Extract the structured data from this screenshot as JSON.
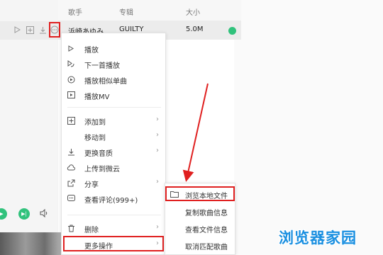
{
  "table": {
    "headers": {
      "artist": "歌手",
      "album": "专辑",
      "size": "大小"
    },
    "row": {
      "artist": "浜崎あゆみ",
      "album": "GUILTY",
      "size": "5.0M"
    },
    "row_icons": [
      "play-icon",
      "add-icon",
      "download-icon",
      "more-icon"
    ],
    "status_color": "#31c27c"
  },
  "context_menu": {
    "items": [
      {
        "label": "播放",
        "icon": "play-icon",
        "submenu": false
      },
      {
        "label": "下一首播放",
        "icon": "play-next-icon",
        "submenu": false
      },
      {
        "label": "播放相似单曲",
        "icon": "similar-icon",
        "submenu": false
      },
      {
        "label": "播放MV",
        "icon": "mv-icon",
        "submenu": false
      },
      {
        "label": "添加到",
        "icon": "add-to-icon",
        "submenu": true
      },
      {
        "label": "移动到",
        "icon": "",
        "submenu": true
      },
      {
        "label": "更换音质",
        "icon": "quality-icon",
        "submenu": true
      },
      {
        "label": "上传到微云",
        "icon": "cloud-icon",
        "submenu": false
      },
      {
        "label": "分享",
        "icon": "share-icon",
        "submenu": true
      },
      {
        "label": "查看评论(999+)",
        "icon": "comment-icon",
        "submenu": false
      },
      {
        "label": "删除",
        "icon": "delete-icon",
        "submenu": true
      },
      {
        "label": "更多操作",
        "icon": "",
        "submenu": true
      }
    ]
  },
  "submenu": {
    "items": [
      {
        "label": "浏览本地文件",
        "icon": "folder-icon"
      },
      {
        "label": "复制歌曲信息",
        "icon": ""
      },
      {
        "label": "查看文件信息",
        "icon": ""
      },
      {
        "label": "取消匹配歌曲",
        "icon": ""
      }
    ]
  },
  "watermark": "浏览器家园",
  "colors": {
    "highlight": "#e02020",
    "accent": "#31c27c",
    "watermark": "#1a8fe0"
  }
}
